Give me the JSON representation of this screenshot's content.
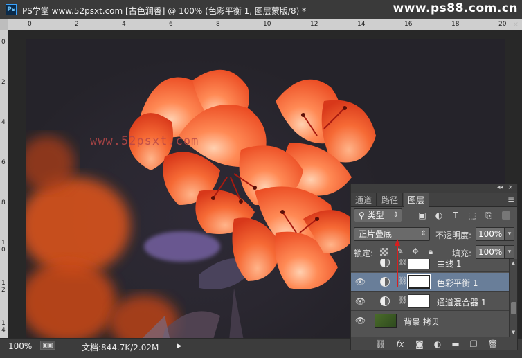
{
  "window": {
    "app_icon": "Ps",
    "title": "PS学堂 www.52psxt.com [古色润香] @ 100% (色彩平衡 1, 图层蒙版/8) *",
    "watermark": "www.ps88.com.cn",
    "close_icon": "×"
  },
  "rulers": {
    "top_ticks": [
      "0",
      "2",
      "4",
      "6",
      "8",
      "10",
      "12",
      "14",
      "16",
      "18",
      "20"
    ],
    "left_ticks": [
      "0",
      "2",
      "4",
      "6",
      "8",
      "1 0",
      "1 2",
      "1 4"
    ]
  },
  "canvas": {
    "watermark": "www.52psxt.com"
  },
  "statusbar": {
    "zoom": "100%",
    "doc_label": "文档:844.7K/2.02M",
    "menu_arrow": "▶"
  },
  "layers_panel": {
    "collapse": "◂◂",
    "close": "×",
    "tabs": [
      {
        "label": "通道",
        "active": false
      },
      {
        "label": "路径",
        "active": false
      },
      {
        "label": "图层",
        "active": true
      }
    ],
    "tab_menu": "≡",
    "filter": {
      "label": "类型",
      "icon": "search-icon"
    },
    "blend_mode": "正片叠底",
    "opacity_label": "不透明度:",
    "opacity_value": "100%",
    "lock_label": "锁定:",
    "fill_label": "填充:",
    "fill_value": "100%",
    "layers": [
      {
        "name": "曲线 1",
        "visible": false,
        "type": "adjustment",
        "selected": false
      },
      {
        "name": "色彩平衡 1",
        "visible": true,
        "type": "adjustment",
        "selected": true
      },
      {
        "name": "通道混合器 1",
        "visible": true,
        "type": "adjustment",
        "selected": false
      },
      {
        "name": "背景 拷贝",
        "visible": true,
        "type": "image",
        "selected": false
      }
    ],
    "bottom_icons": [
      "link-icon",
      "fx-icon",
      "mask-icon",
      "adjustment-icon",
      "folder-icon",
      "new-layer-icon",
      "trash-icon"
    ],
    "fx_label": "fx"
  },
  "colors": {
    "accent_selected_layer": "#697e99",
    "flower_orange": "#f05a28",
    "annotation_arrow": "#d81f1f"
  }
}
